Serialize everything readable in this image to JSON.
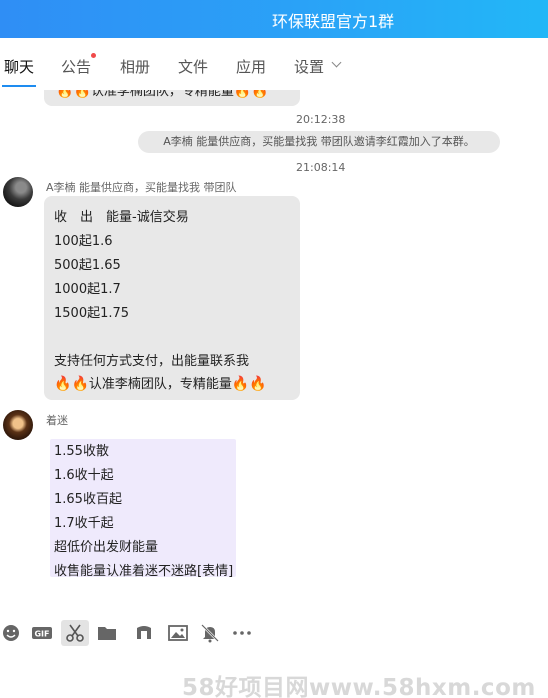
{
  "window": {
    "title": "环保联盟官方1群"
  },
  "tabs": [
    {
      "label": "聊天",
      "active": true
    },
    {
      "label": "公告",
      "badge": true
    },
    {
      "label": "相册"
    },
    {
      "label": "文件"
    },
    {
      "label": "应用"
    },
    {
      "label": "设置"
    }
  ],
  "chat": {
    "partial_top_line": "认准李楠团队，专精能量",
    "timestamp1": "20:12:38",
    "system_notice": "A李楠 能量供应商，买能量找我 带团队邀请李红霞加入了本群。",
    "timestamp2": "21:08:14",
    "messages": [
      {
        "sender": "A李楠 能量供应商，买能量找我 带团队",
        "lines": [
          "收　出　能量-诚信交易",
          "100起1.6",
          "500起1.65",
          "1000起1.7",
          "1500起1.75",
          "",
          "支持任何方式支付，出能量联系我",
          "认准李楠团队，专精能量"
        ]
      },
      {
        "sender": "着迷",
        "lines": [
          "1.55收散",
          "1.6收十起",
          "1.65收百起",
          "1.7收千起",
          "超低价出发财能量",
          "收售能量认准着迷不迷路[表情]"
        ]
      }
    ]
  },
  "toolbar": {
    "icons": [
      "emoji-icon",
      "gif-icon",
      "scissors-icon",
      "folder-icon",
      "music-icon",
      "image-icon",
      "bell-off-icon",
      "more-icon"
    ],
    "gif_label": "GIF"
  },
  "watermark": "58好项目网www.58hxm.com"
}
